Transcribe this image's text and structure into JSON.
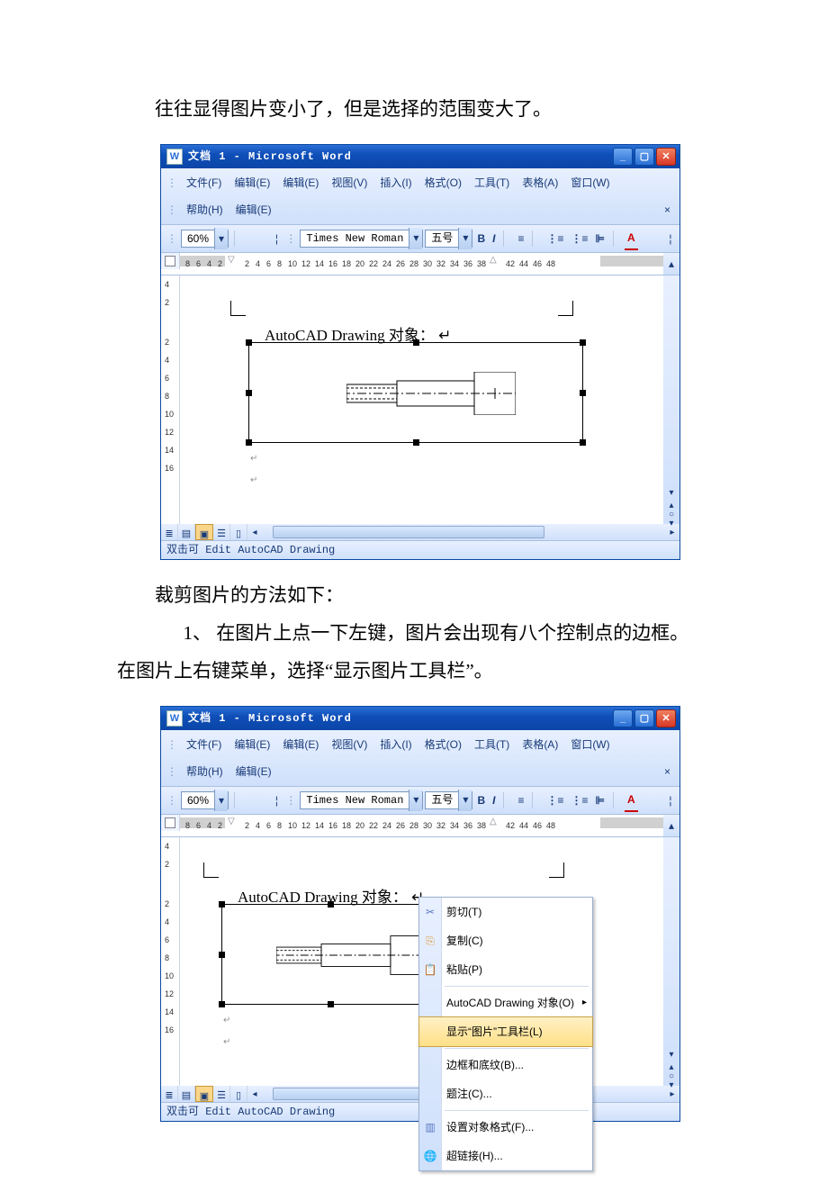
{
  "text": {
    "line1": "往往显得图片变小了，但是选择的范围变大了。",
    "line2": "裁剪图片的方法如下：",
    "line3_num": "1、",
    "line3a": "在图片上点一下左键，图片会出现有八个控制点的边框。",
    "line4": "在图片上右键菜单，选择“显示图片工具栏”。"
  },
  "win": {
    "title": "文档 1 - Microsoft Word",
    "menu": {
      "file": "文件(F)",
      "edit1": "编辑(E)",
      "edit2": "编辑(E)",
      "view": "视图(V)",
      "insert": "插入(I)",
      "format": "格式(O)",
      "tools": "工具(T)",
      "table": "表格(A)",
      "window": "窗口(W)",
      "help": "帮助(H)",
      "edit3": "编辑(E)"
    },
    "toolbar": {
      "zoom": "60%",
      "font": "Times New Roman",
      "size": "五号",
      "bold": "B",
      "italic": "I"
    },
    "ruler_nums_left": [
      "8",
      "6",
      "4",
      "2"
    ],
    "ruler_nums_right": [
      "2",
      "4",
      "6",
      "8",
      "10",
      "12",
      "14",
      "16",
      "18",
      "20",
      "22",
      "24",
      "26",
      "28",
      "30",
      "32",
      "34",
      "36",
      "38"
    ],
    "ruler_nums_far": [
      "42",
      "44",
      "46",
      "48"
    ],
    "vruler_nums": [
      "4",
      "2",
      "2",
      "4",
      "6",
      "8",
      "10",
      "12",
      "14",
      "16"
    ],
    "doc_text": "AutoCAD Drawing 对象：",
    "status": "双击可 Edit AutoCAD Drawing"
  },
  "context_menu": {
    "cut": "剪切(T)",
    "copy": "复制(C)",
    "paste": "粘贴(P)",
    "obj": "AutoCAD Drawing 对象(O)",
    "show_toolbar": "显示“图片”工具栏(L)",
    "borders": "边框和底纹(B)...",
    "caption": "题注(C)...",
    "format_obj": "设置对象格式(F)...",
    "hyperlink": "超链接(H)..."
  }
}
